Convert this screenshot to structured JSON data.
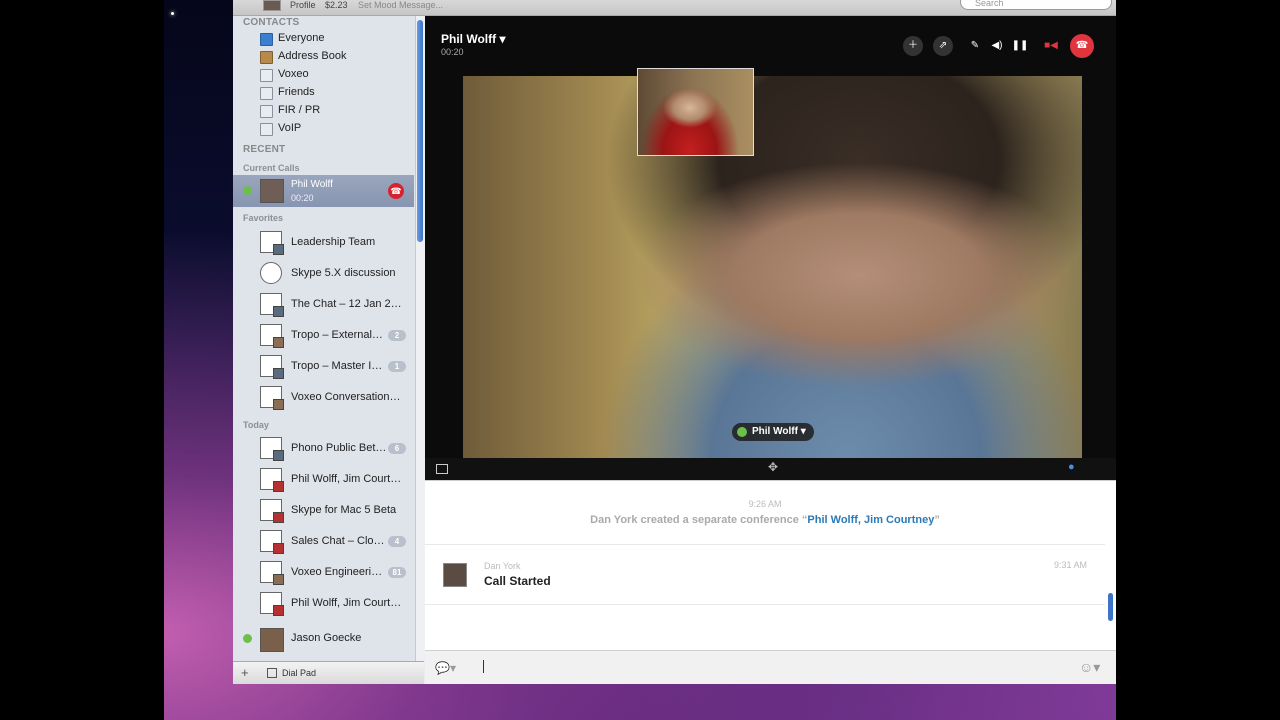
{
  "topbar": {
    "profile": "Profile",
    "credit": "$2.23",
    "mood": "Set Mood Message...",
    "search_placeholder": "Search"
  },
  "sidebar": {
    "contacts_header": "CONTACTS",
    "groups": [
      {
        "label": "Everyone",
        "icon": "everyone-icon"
      },
      {
        "label": "Address Book",
        "icon": "address-book-icon"
      },
      {
        "label": "Voxeo",
        "icon": "group-icon"
      },
      {
        "label": "Friends",
        "icon": "group-icon"
      },
      {
        "label": "FIR / PR",
        "icon": "group-icon"
      },
      {
        "label": "VoIP",
        "icon": "group-icon"
      }
    ],
    "recent_header": "RECENT",
    "current_calls_header": "Current Calls",
    "current_call": {
      "name": "Phil Wolff",
      "time": "00:20"
    },
    "favorites_header": "Favorites",
    "favorites": [
      {
        "label": "Leadership Team",
        "badge": ""
      },
      {
        "label": "Skype 5.X discussion",
        "badge": ""
      },
      {
        "label": "The Chat – 12 Jan 2…",
        "badge": ""
      },
      {
        "label": "Tropo – External…",
        "badge": "2"
      },
      {
        "label": "Tropo – Master I…",
        "badge": "1"
      },
      {
        "label": "Voxeo Conversation…",
        "badge": ""
      }
    ],
    "today_header": "Today",
    "today": [
      {
        "label": "Phono Public Bet…",
        "badge": "6"
      },
      {
        "label": "Phil Wolff, Jim Court…",
        "badge": ""
      },
      {
        "label": "Skype for Mac 5 Beta",
        "badge": ""
      },
      {
        "label": "Sales Chat – Clo…",
        "badge": "4"
      },
      {
        "label": "Voxeo Engineeri…",
        "badge": "81"
      },
      {
        "label": "Phil Wolff, Jim Court…",
        "badge": ""
      }
    ],
    "contact": {
      "name": "Jason Goecke"
    },
    "dial_pad": "Dial Pad"
  },
  "video": {
    "title": "Phil Wolff",
    "time": "00:20",
    "caller_label": "Phil Wolff"
  },
  "chat": {
    "event_time": "9:26 AM",
    "event_text": "Dan York created a separate conference",
    "event_link": "Phil Wolff, Jim Courtney",
    "message": {
      "author": "Dan York",
      "text": "Call Started",
      "time": "9:31 AM"
    }
  },
  "colors": {
    "accent": "#3b74c8",
    "end_call": "#e0353f",
    "online": "#6cc04a"
  }
}
